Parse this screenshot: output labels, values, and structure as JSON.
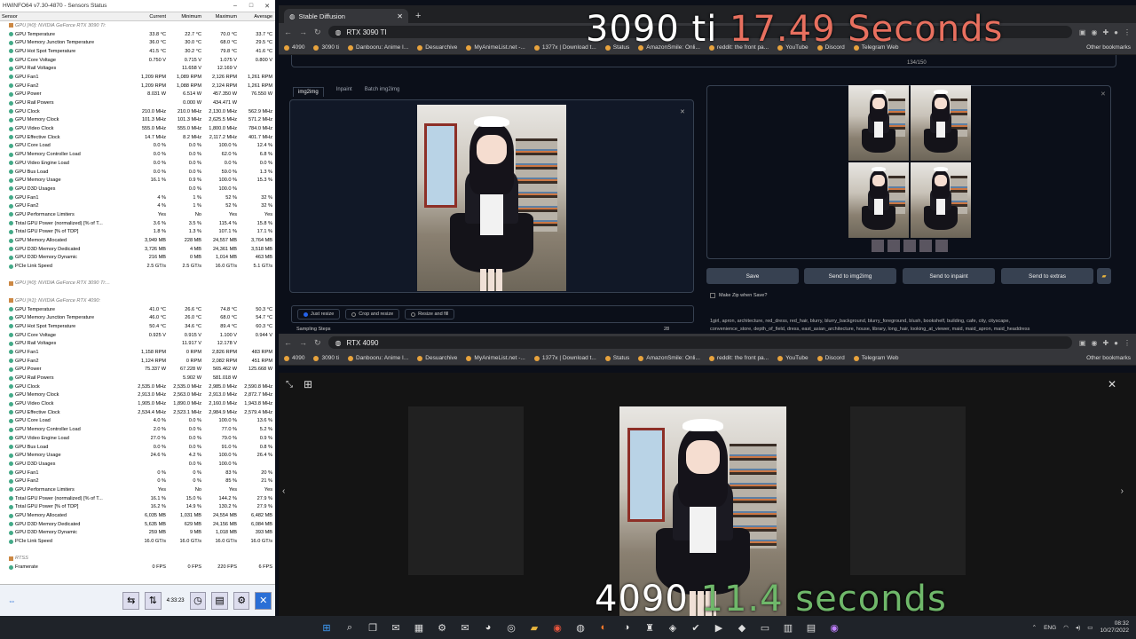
{
  "hwinfo": {
    "title": "HWiNFO64 v7.30-4870 - Sensors Status",
    "columns": [
      "Sensor",
      "Current",
      "Minimum",
      "Maximum",
      "Average"
    ],
    "rows": [
      [
        "GPU [#0]: NVIDIA GeForce RTX 3090 Ti:",
        "",
        "",
        "",
        ""
      ],
      [
        "GPU Temperature",
        "33.8 °C",
        "22.7 °C",
        "70.0 °C",
        "33.7 °C"
      ],
      [
        "GPU Memory Junction Temperature",
        "36.0 °C",
        "30.0 °C",
        "68.0 °C",
        "29.5 °C"
      ],
      [
        "GPU Hot Spot Temperature",
        "41.5 °C",
        "30.2 °C",
        "79.8 °C",
        "41.6 °C"
      ],
      [
        "GPU Core Voltage",
        "0.750 V",
        "0.715 V",
        "1.075 V",
        "0.800 V"
      ],
      [
        "GPU Rail Voltages",
        "",
        "11.658 V",
        "12.169 V",
        ""
      ],
      [
        "GPU Fan1",
        "1,209 RPM",
        "1,089 RPM",
        "2,126 RPM",
        "1,261 RPM"
      ],
      [
        "GPU Fan2",
        "1,209 RPM",
        "1,088 RPM",
        "2,124 RPM",
        "1,261 RPM"
      ],
      [
        "GPU Power",
        "8.031 W",
        "6.514 W",
        "457.350 W",
        "76.550 W"
      ],
      [
        "GPU Rail Powers",
        "",
        "0.000 W",
        "434.471 W",
        ""
      ],
      [
        "GPU Clock",
        "210.0 MHz",
        "210.0 MHz",
        "2,130.0 MHz",
        "562.9 MHz"
      ],
      [
        "GPU Memory Clock",
        "101.3 MHz",
        "101.3 MHz",
        "2,625.5 MHz",
        "571.2 MHz"
      ],
      [
        "GPU Video Clock",
        "555.0 MHz",
        "555.0 MHz",
        "1,800.0 MHz",
        "784.0 MHz"
      ],
      [
        "GPU Effective Clock",
        "14.7 MHz",
        "8.2 MHz",
        "2,117.2 MHz",
        "401.7 MHz"
      ],
      [
        "GPU Core Load",
        "0.0 %",
        "0.0 %",
        "100.0 %",
        "12.4 %"
      ],
      [
        "GPU Memory Controller Load",
        "0.0 %",
        "0.0 %",
        "62.0 %",
        "6.8 %"
      ],
      [
        "GPU Video Engine Load",
        "0.0 %",
        "0.0 %",
        "0.0 %",
        "0.0 %"
      ],
      [
        "GPU Bus Load",
        "0.0 %",
        "0.0 %",
        "59.0 %",
        "1.3 %"
      ],
      [
        "GPU Memory Usage",
        "16.1 %",
        "0.9 %",
        "100.0 %",
        "15.3 %"
      ],
      [
        "GPU D3D Usages",
        "",
        "0.0 %",
        "100.0 %",
        ""
      ],
      [
        "GPU Fan1",
        "4 %",
        "1 %",
        "52 %",
        "32 %"
      ],
      [
        "GPU Fan2",
        "4 %",
        "1 %",
        "52 %",
        "32 %"
      ],
      [
        "GPU Performance Limiters",
        "Yes",
        "No",
        "Yes",
        "Yes"
      ],
      [
        "Total GPU Power (normalized) [% of T...",
        "3.6 %",
        "3.5 %",
        "115.4 %",
        "15.8 %"
      ],
      [
        "Total GPU Power [% of TDP]",
        "1.8 %",
        "1.3 %",
        "107.1 %",
        "17.1 %"
      ],
      [
        "GPU Memory Allocated",
        "3,949 MB",
        "228 MB",
        "24,557 MB",
        "3,764 MB"
      ],
      [
        "GPU D3D Memory Dedicated",
        "3,726 MB",
        "4 MB",
        "24,361 MB",
        "3,518 MB"
      ],
      [
        "GPU D3D Memory Dynamic",
        "216 MB",
        "0 MB",
        "1,014 MB",
        "463 MB"
      ],
      [
        "PCIe Link Speed",
        "2.5 GT/s",
        "2.5 GT/s",
        "16.0 GT/s",
        "5.1 GT/s"
      ],
      [
        "",
        "",
        "",
        "",
        ""
      ],
      [
        "GPU [#0]: NVIDIA GeForce RTX 3090 Ti:...",
        "",
        "",
        "",
        ""
      ],
      [
        "",
        "",
        "",
        "",
        ""
      ],
      [
        "GPU [#1]: NVIDIA GeForce RTX 4090:",
        "",
        "",
        "",
        ""
      ],
      [
        "GPU Temperature",
        "41.0 °C",
        "26.6 °C",
        "74.8 °C",
        "50.3 °C"
      ],
      [
        "GPU Memory Junction Temperature",
        "46.0 °C",
        "26.0 °C",
        "68.0 °C",
        "54.7 °C"
      ],
      [
        "GPU Hot Spot Temperature",
        "50.4 °C",
        "34.6 °C",
        "89.4 °C",
        "60.3 °C"
      ],
      [
        "GPU Core Voltage",
        "0.925 V",
        "0.915 V",
        "1.100 V",
        "0.944 V"
      ],
      [
        "GPU Rail Voltages",
        "",
        "11.917 V",
        "12.178 V",
        ""
      ],
      [
        "GPU Fan1",
        "1,158 RPM",
        "0 RPM",
        "2,826 RPM",
        "483 RPM"
      ],
      [
        "GPU Fan2",
        "1,124 RPM",
        "0 RPM",
        "2,082 RPM",
        "451 RPM"
      ],
      [
        "GPU Power",
        "75.337 W",
        "67.228 W",
        "565.462 W",
        "125.668 W"
      ],
      [
        "GPU Rail Powers",
        "",
        "5.902 W",
        "581.018 W",
        ""
      ],
      [
        "GPU Clock",
        "2,535.0 MHz",
        "2,535.0 MHz",
        "2,985.0 MHz",
        "2,590.8 MHz"
      ],
      [
        "GPU Memory Clock",
        "2,913.0 MHz",
        "2,563.0 MHz",
        "2,913.0 MHz",
        "2,872.7 MHz"
      ],
      [
        "GPU Video Clock",
        "1,905.0 MHz",
        "1,890.0 MHz",
        "2,160.0 MHz",
        "1,943.8 MHz"
      ],
      [
        "GPU Effective Clock",
        "2,534.4 MHz",
        "2,523.1 MHz",
        "2,984.9 MHz",
        "2,579.4 MHz"
      ],
      [
        "GPU Core Load",
        "4.0 %",
        "0.0 %",
        "100.0 %",
        "13.6 %"
      ],
      [
        "GPU Memory Controller Load",
        "2.0 %",
        "0.0 %",
        "77.0 %",
        "5.2 %"
      ],
      [
        "GPU Video Engine Load",
        "27.0 %",
        "0.0 %",
        "79.0 %",
        "0.9 %"
      ],
      [
        "GPU Bus Load",
        "0.0 %",
        "0.0 %",
        "91.0 %",
        "0.8 %"
      ],
      [
        "GPU Memory Usage",
        "24.6 %",
        "4.2 %",
        "100.0 %",
        "26.4 %"
      ],
      [
        "GPU D3D Usages",
        "",
        "0.0 %",
        "100.0 %",
        ""
      ],
      [
        "GPU Fan1",
        "0 %",
        "0 %",
        "83 %",
        "20 %"
      ],
      [
        "GPU Fan2",
        "0 %",
        "0 %",
        "85 %",
        "21 %"
      ],
      [
        "GPU Performance Limiters",
        "Yes",
        "No",
        "Yes",
        "Yes"
      ],
      [
        "Total GPU Power (normalized) [% of T...",
        "16.1 %",
        "15.0 %",
        "144.2 %",
        "27.9 %"
      ],
      [
        "Total GPU Power [% of TDP]",
        "16.2 %",
        "14.9 %",
        "130.2 %",
        "27.9 %"
      ],
      [
        "GPU Memory Allocated",
        "6,035 MB",
        "1,031 MB",
        "24,554 MB",
        "6,482 MB"
      ],
      [
        "GPU D3D Memory Dedicated",
        "5,635 MB",
        "629 MB",
        "24,156 MB",
        "6,084 MB"
      ],
      [
        "GPU D3D Memory Dynamic",
        "259 MB",
        "9 MB",
        "1,018 MB",
        "393 MB"
      ],
      [
        "PCIe Link Speed",
        "16.0 GT/s",
        "16.0 GT/s",
        "16.0 GT/s",
        "16.0 GT/s"
      ],
      [
        "",
        "",
        "",
        "",
        ""
      ],
      [
        "RTSS",
        "",
        "",
        "",
        ""
      ],
      [
        "Framerate",
        "0 FPS",
        "0 FPS",
        "220 FPS",
        "6 FPS"
      ]
    ],
    "footer_time": "4:33:23"
  },
  "browser_top": {
    "tab_title": "Stable Diffusion",
    "address": "RTX 3090 TI",
    "progress": "134/150"
  },
  "browser_bottom": {
    "address": "RTX 4090"
  },
  "bookmarks": [
    "4090",
    "3090 ti",
    "Danbooru: Anime I...",
    "Desuarchive",
    "MyAnimeList.net -...",
    "1377x | Download t...",
    "Status",
    "AmazonSmile: Onli...",
    "reddit: the front pa...",
    "YouTube",
    "Discord",
    "Telegram Web"
  ],
  "other_bookmarks": "Other bookmarks",
  "sd": {
    "tabs": [
      "img2img",
      "Inpaint",
      "Batch img2img"
    ],
    "buttons": [
      "Save",
      "Send to img2img",
      "Send to inpaint",
      "Send to extras"
    ],
    "zip_label": "Make Zip when Save?",
    "resize_options": [
      "Just resize",
      "Crop and resize",
      "Resize and fill"
    ],
    "sampling_label": "Sampling Steps",
    "sampling_value": "28",
    "prompt": "1girl, apron, architecture, red_dress, red_hair, blurry, blurry_background, blurry_foreground, blush, bookshelf, building, cafe, city, cityscape,",
    "prompt2": "convenience_store, depth_of_field, dress, east_asian_architecture, house, library, long_hair, looking_at_viewer, maid, maid_apron, maid_headdress"
  },
  "overlay": {
    "top_card": "3090 ti",
    "top_time": "17.49 Seconds",
    "bottom_card": "4090",
    "bottom_time_a": "11.4",
    "bottom_time_b": " seconds",
    "colors": {
      "top": "#e8705f",
      "bottom": "#6fb86a"
    }
  },
  "tray": {
    "lang": "ENG",
    "time": "08:32",
    "date": "10/27/2022"
  }
}
